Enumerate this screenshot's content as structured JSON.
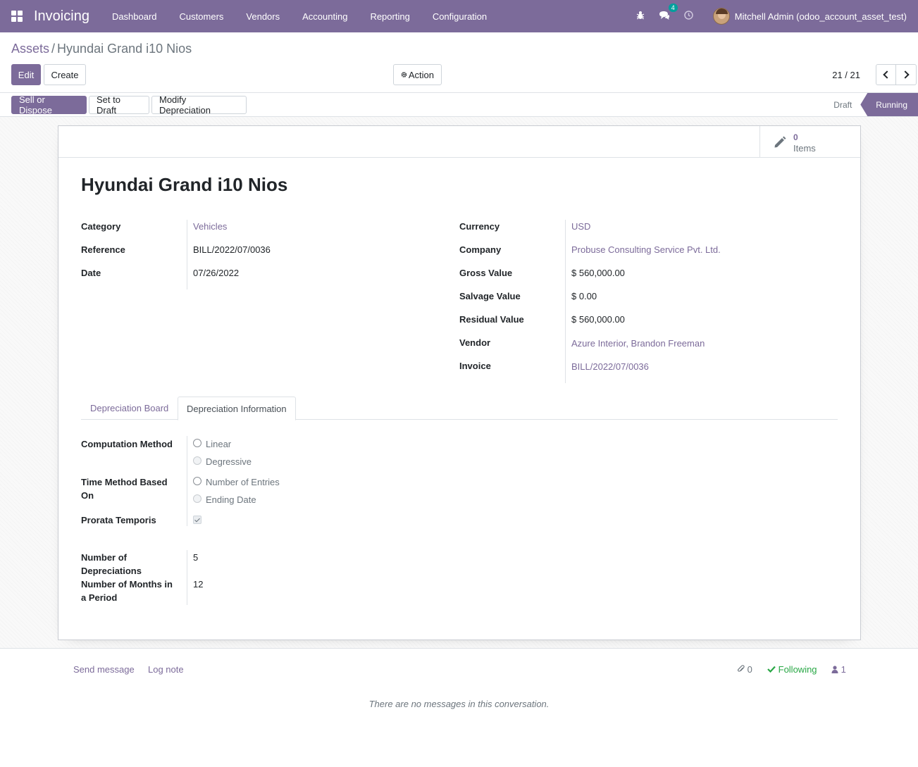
{
  "navbar": {
    "app_name": "Invoicing",
    "menu": [
      "Dashboard",
      "Customers",
      "Vendors",
      "Accounting",
      "Reporting",
      "Configuration"
    ],
    "message_count": "4",
    "user": "Mitchell Admin (odoo_account_asset_test)",
    "accent_color": "#7c6b9a"
  },
  "breadcrumb": {
    "parent": "Assets",
    "separator": "/",
    "current": "Hyundai Grand i10 Nios"
  },
  "controls": {
    "edit": "Edit",
    "create": "Create",
    "action": "Action",
    "pager": "21 / 21"
  },
  "statusbar": {
    "buttons": [
      "Sell or Dispose",
      "Set to Draft",
      "Modify Depreciation"
    ],
    "stages": [
      "Draft",
      "Running"
    ],
    "active_stage": "Running"
  },
  "stat": {
    "value": "0",
    "label": "Items"
  },
  "record": {
    "title": "Hyundai Grand i10 Nios",
    "left": [
      {
        "label": "Category",
        "value": "Vehicles",
        "link": true
      },
      {
        "label": "Reference",
        "value": "BILL/2022/07/0036",
        "link": false
      },
      {
        "label": "Date",
        "value": "07/26/2022",
        "link": false
      }
    ],
    "right": [
      {
        "label": "Currency",
        "value": "USD",
        "link": true
      },
      {
        "label": "Company",
        "value": "Probuse Consulting Service Pvt. Ltd.",
        "link": true
      },
      {
        "label": "Gross Value",
        "value": "$ 560,000.00",
        "link": false
      },
      {
        "label": "Salvage Value",
        "value": "$ 0.00",
        "link": false
      },
      {
        "label": "Residual Value",
        "value": "$ 560,000.00",
        "link": false
      },
      {
        "label": "Vendor",
        "value": "Azure Interior, Brandon Freeman",
        "link": true
      },
      {
        "label": "Invoice",
        "value": "BILL/2022/07/0036",
        "link": true
      }
    ]
  },
  "tabs": [
    "Depreciation Board",
    "Depreciation Information"
  ],
  "depreciation": {
    "computation_method_label": "Computation Method",
    "computation_options": [
      "Linear",
      "Degressive"
    ],
    "time_method_label_1": "Time Method Based",
    "time_method_label_2": "On",
    "time_options": [
      "Number of Entries",
      "Ending Date"
    ],
    "prorata_label": "Prorata Temporis",
    "prorata_checked": true,
    "num_dep_label_1": "Number of",
    "num_dep_label_2": "Depreciations",
    "num_dep_value": "5",
    "months_label_1": "Number of Months in",
    "months_label_2": "a Period",
    "months_value": "12"
  },
  "chatter": {
    "send_message": "Send message",
    "log_note": "Log note",
    "attachments": "0",
    "following": "Following",
    "followers": "1",
    "empty": "There are no messages in this conversation."
  }
}
